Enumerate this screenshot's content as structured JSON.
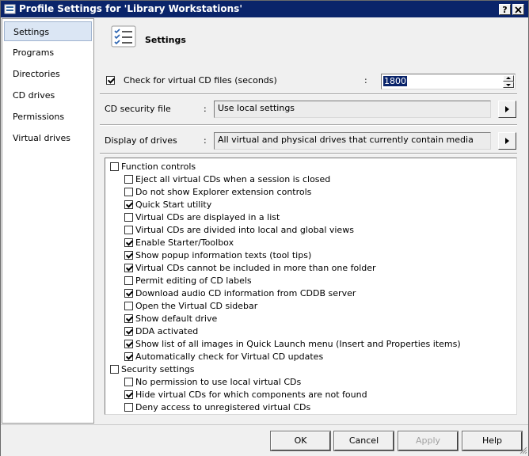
{
  "window": {
    "title": "Profile Settings for 'Library Workstations'",
    "help_button": "?",
    "close_button": "X"
  },
  "nav": {
    "items": [
      {
        "label": "Settings",
        "selected": true
      },
      {
        "label": "Programs",
        "selected": false
      },
      {
        "label": "Directories",
        "selected": false
      },
      {
        "label": "CD drives",
        "selected": false
      },
      {
        "label": "Permissions",
        "selected": false
      },
      {
        "label": "Virtual drives",
        "selected": false
      }
    ]
  },
  "header": {
    "title": "Settings",
    "icon": "checklist-icon"
  },
  "check_virtual": {
    "checked": true,
    "label": "Check for virtual CD files (seconds)",
    "colon": ":",
    "value": "1800"
  },
  "cd_security": {
    "label": "CD security file",
    "colon": ":",
    "value": "Use local settings"
  },
  "display_drives": {
    "label": "Display of drives",
    "colon": ":",
    "value": "All virtual and physical drives that currently contain media"
  },
  "options": [
    {
      "label": "Function controls",
      "checked": false,
      "level": 0
    },
    {
      "label": "Eject all virtual CDs when a session is closed",
      "checked": false,
      "level": 1
    },
    {
      "label": "Do not show Explorer extension controls",
      "checked": false,
      "level": 1
    },
    {
      "label": "Quick Start utility",
      "checked": true,
      "level": 1
    },
    {
      "label": "Virtual CDs are displayed in a list",
      "checked": false,
      "level": 1
    },
    {
      "label": "Virtual CDs are divided into local and global views",
      "checked": false,
      "level": 1
    },
    {
      "label": "Enable Starter/Toolbox",
      "checked": true,
      "level": 1
    },
    {
      "label": "Show popup information texts (tool tips)",
      "checked": true,
      "level": 1
    },
    {
      "label": "Virtual CDs cannot be included in more than one folder",
      "checked": true,
      "level": 1
    },
    {
      "label": "Permit editing of CD labels",
      "checked": false,
      "level": 1
    },
    {
      "label": "Download audio CD information from CDDB server",
      "checked": true,
      "level": 1
    },
    {
      "label": "Open the Virtual CD sidebar",
      "checked": false,
      "level": 1
    },
    {
      "label": "Show default drive",
      "checked": true,
      "level": 1
    },
    {
      "label": "DDA activated",
      "checked": true,
      "level": 1
    },
    {
      "label": "Show list of all images in Quick Launch menu (Insert and Properties items)",
      "checked": true,
      "level": 1
    },
    {
      "label": "Automatically check for Virtual CD updates",
      "checked": true,
      "level": 1
    },
    {
      "label": "Security settings",
      "checked": false,
      "level": 0
    },
    {
      "label": "No permission to use local virtual CDs",
      "checked": false,
      "level": 1
    },
    {
      "label": "Hide virtual CDs for which components are not found",
      "checked": true,
      "level": 1
    },
    {
      "label": "Deny access to unregistered virtual CDs",
      "checked": false,
      "level": 1
    }
  ],
  "buttons": {
    "ok": "OK",
    "cancel": "Cancel",
    "apply": "Apply",
    "apply_enabled": false,
    "help": "Help"
  }
}
